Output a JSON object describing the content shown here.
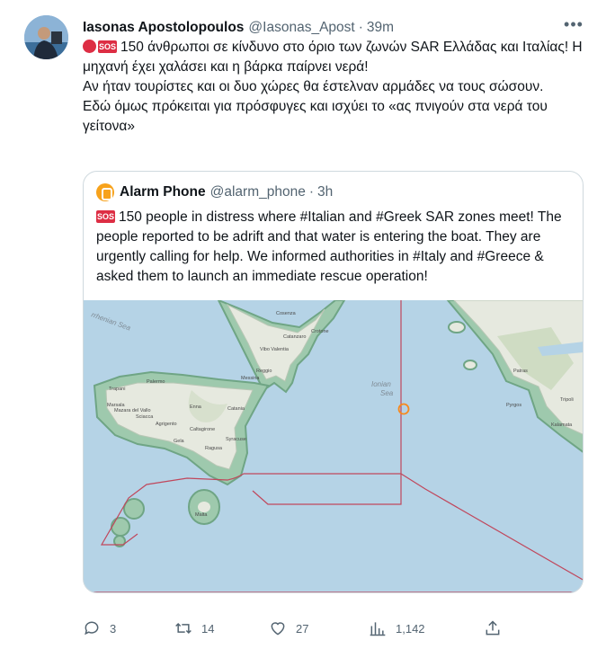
{
  "author": {
    "display_name": "Iasonas Apostolopoulos",
    "handle": "@Iasonas_Apost",
    "separator": "·",
    "time": "39m"
  },
  "more_label": "•••",
  "tweet": {
    "line1": "150 άνθρωποι σε κίνδυνο στο όριο των ζωνών SAR Ελλάδας και Ιταλίας! Η μηχανή έχει χαλάσει και η βάρκα παίρνει νερά!",
    "line2": "Αν ήταν τουρίστες και οι δυο χώρες θα έστελναν αρμάδες να τους σώσουν.",
    "line3": "Εδώ όμως πρόκειται για πρόσφυγες και ισχύει το «ας πνιγούν στα νερά του γείτονα»",
    "sos_badge": "SOS"
  },
  "quoted": {
    "display_name": "Alarm Phone",
    "handle": "@alarm_phone",
    "separator": "·",
    "time": "3h",
    "sos_badge": "SOS",
    "text": "150 people in distress where #Italian and #Greek SAR zones meet! The people reported to be adrift and that water is entering the boat. They are urgently calling for help. We informed authorities in #Italy and #Greece & asked them to launch an immediate rescue operation!"
  },
  "map": {
    "sea_label_tyrrhenian": "rrhenian Sea",
    "sea_label_ionian_1": "Ionian",
    "sea_label_ionian_2": "Sea",
    "places": {
      "cosenza": "Cosenza",
      "crotone": "Crotone",
      "catanzaro": "Catanzaro",
      "vibo": "Vibo Valentia",
      "reggio": "Reggio",
      "palermo": "Palermo",
      "messina": "Messina",
      "trapani": "Trapani",
      "marsala": "Marsala",
      "mazara": "Mazara del Vallo",
      "sciacca": "Sciacca",
      "agrigento": "Agrigento",
      "enna": "Enna",
      "catania": "Catania",
      "caltagirone": "Caltagirone",
      "gela": "Gela",
      "siracusa": "Syracuse",
      "ragusa": "Ragusa",
      "malta": "Malta",
      "patras": "Patras",
      "pyrgos": "Pyrgos",
      "kalamata": "Kalamata",
      "tripoli": "Tripoli"
    },
    "colors": {
      "sea": "#b5d3e6",
      "land": "#eceee6",
      "zone_border": "#c0475c",
      "coast_buffer": "#8fbf9f",
      "marker": "#f7891e"
    }
  },
  "actions": {
    "reply_count": "3",
    "retweet_count": "14",
    "like_count": "27",
    "views_count": "1,142"
  },
  "colors": {
    "text": "#0f1419",
    "muted": "#536471",
    "border": "#cfd9de",
    "sos_red": "#dd2e44"
  }
}
